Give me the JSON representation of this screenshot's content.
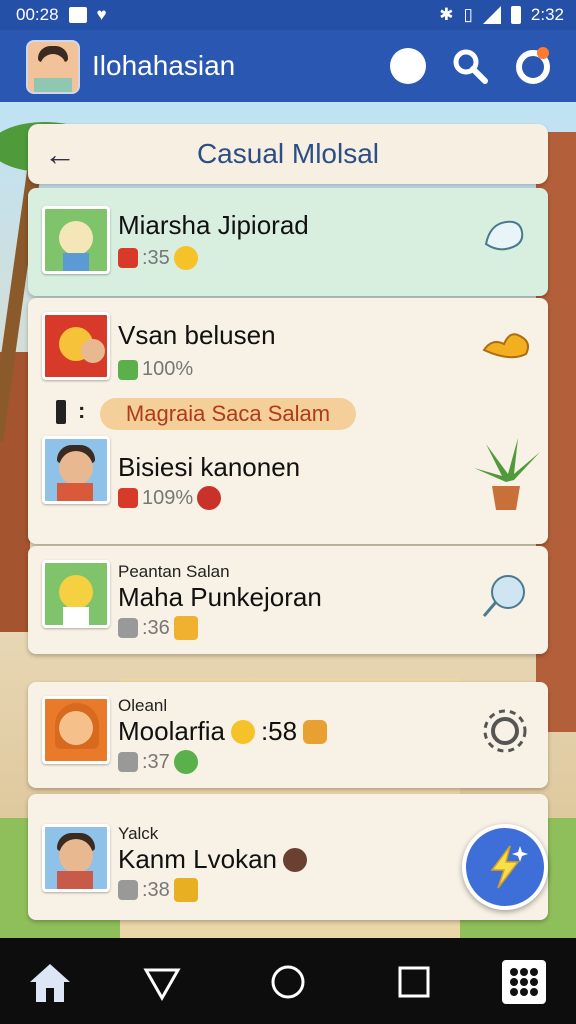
{
  "status_bar": {
    "time_left": "00:28",
    "time_right": "2:32"
  },
  "app_bar": {
    "title": "Ilohahasian"
  },
  "header": {
    "title": "Casual Mlolsal"
  },
  "chats": [
    {
      "name": "Miarsha Jipiorad",
      "meta": ":35"
    },
    {
      "name": "Vsan belusen",
      "meta": "100%"
    },
    {
      "name": "Bisiesi kanonen",
      "meta": "109%"
    },
    {
      "prelabel": "Peantan Salan",
      "name": "Maha Punkejoran",
      "meta": ":36"
    },
    {
      "prelabel": "Oleanl",
      "name": "Moolarfia",
      "name_suffix": ":58",
      "meta": ":37"
    },
    {
      "prelabel": "Yalck",
      "name": "Kanm Lvokan",
      "meta": ":38"
    }
  ],
  "typing": {
    "text": "Magraia Saca Salam"
  },
  "colors": {
    "primary": "#2a57b2",
    "card": "#f8f1e5",
    "highlight": "#d8efe0",
    "pill": "#f5cf9a"
  },
  "icons": [
    "search-icon",
    "notification-icon",
    "back-arrow-icon",
    "settings-gear-icon",
    "lightning-icon",
    "home-icon",
    "back-triangle-icon",
    "circle-home-icon",
    "square-recents-icon",
    "grid-apps-icon"
  ]
}
